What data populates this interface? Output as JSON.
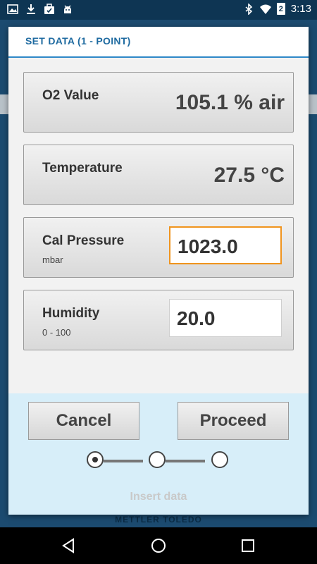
{
  "status_bar": {
    "time": "3:13",
    "battery_level": "2",
    "icons": [
      "image-icon",
      "download-icon",
      "briefcase-icon",
      "android-icon",
      "bluetooth-icon",
      "wifi-icon",
      "battery-icon"
    ]
  },
  "background": {
    "footer_brand": "METTLER TOLEDO"
  },
  "dialog": {
    "title": "SET DATA (1 - POINT)",
    "rows": [
      {
        "label": "O2 Value",
        "value": "105.1 % air"
      },
      {
        "label": "Temperature",
        "value": "27.5 °C"
      },
      {
        "label": "Cal Pressure",
        "sublabel": "mbar",
        "input_value": "1023.0"
      },
      {
        "label": "Humidity",
        "sublabel": "0 - 100",
        "input_value": "20.0"
      }
    ],
    "buttons": {
      "cancel": "Cancel",
      "proceed": "Proceed"
    },
    "steps": {
      "current": 1,
      "total": 3
    },
    "caption": "Insert data"
  },
  "colors": {
    "accent": "#1e6aa0",
    "focus": "#f0941e",
    "bottom_panel": "#d7eef9"
  }
}
